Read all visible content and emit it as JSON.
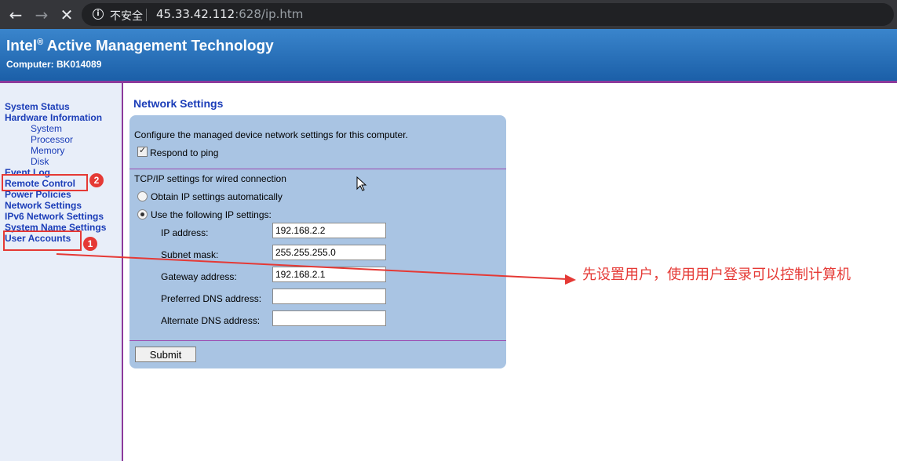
{
  "browser": {
    "back_icon": "arrow-left-icon",
    "forward_icon": "arrow-right-icon",
    "stop_icon": "close-icon",
    "insecure_label": "不安全",
    "url_host": "45.33.42.112",
    "url_rest": ":628/ip.htm"
  },
  "header": {
    "title_main": "Intel",
    "title_reg": "®",
    "title_rest": " Active Management Technology",
    "computer": "Computer: BK014089"
  },
  "sidebar": {
    "items": [
      {
        "label": "System Status"
      },
      {
        "label": "Hardware Information"
      },
      {
        "label": "Event Log"
      },
      {
        "label": "Remote Control"
      },
      {
        "label": "Power Policies"
      },
      {
        "label": "Network Settings"
      },
      {
        "label": "IPv6 Network Settings"
      },
      {
        "label": "System Name Settings"
      },
      {
        "label": "User Accounts"
      }
    ],
    "hardware_sub": [
      {
        "label": "System"
      },
      {
        "label": "Processor"
      },
      {
        "label": "Memory"
      },
      {
        "label": "Disk"
      }
    ]
  },
  "main": {
    "title": "Network Settings",
    "description": "Configure the managed device network settings for this computer.",
    "respond_to_ping": "Respond to ping",
    "respond_checked": true,
    "tcpip_heading": "TCP/IP settings for wired connection",
    "obtain_auto": "Obtain IP settings automatically",
    "use_following": "Use the following IP settings:",
    "fields": {
      "ip_label": "IP address:",
      "ip_value": "192.168.2.2",
      "subnet_label": "Subnet mask:",
      "subnet_value": "255.255.255.0",
      "gateway_label": "Gateway address:",
      "gateway_value": "192.168.2.1",
      "dns1_label": "Preferred DNS address:",
      "dns1_value": "",
      "dns2_label": "Alternate DNS address:",
      "dns2_value": ""
    },
    "submit": "Submit"
  },
  "annotations": {
    "badge1": "1",
    "badge2": "2",
    "note": "先设置用户，使用用户登录可以控制计算机",
    "color": "#e53935"
  }
}
